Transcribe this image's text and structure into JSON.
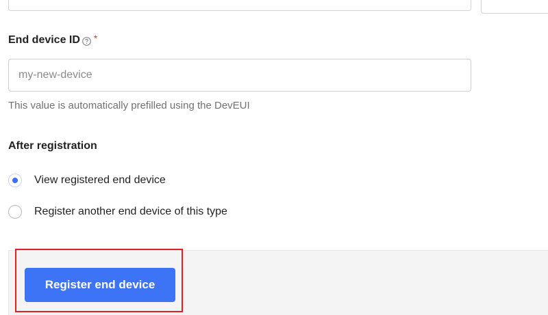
{
  "end_device_id": {
    "label": "End device ID",
    "required_mark": "*",
    "help_icon": "help-circle-icon",
    "placeholder": "my-new-device",
    "value": "",
    "description": "This value is automatically prefilled using the DevEUI"
  },
  "after_registration": {
    "label": "After registration",
    "options": [
      {
        "label": "View registered end device",
        "selected": true
      },
      {
        "label": "Register another end device of this type",
        "selected": false
      }
    ]
  },
  "footer": {
    "submit_label": "Register end device"
  },
  "colors": {
    "primary": "#3d73f5",
    "required": "#e0303c",
    "highlight": "#e02020",
    "footer_background": "#f4f4f4"
  }
}
